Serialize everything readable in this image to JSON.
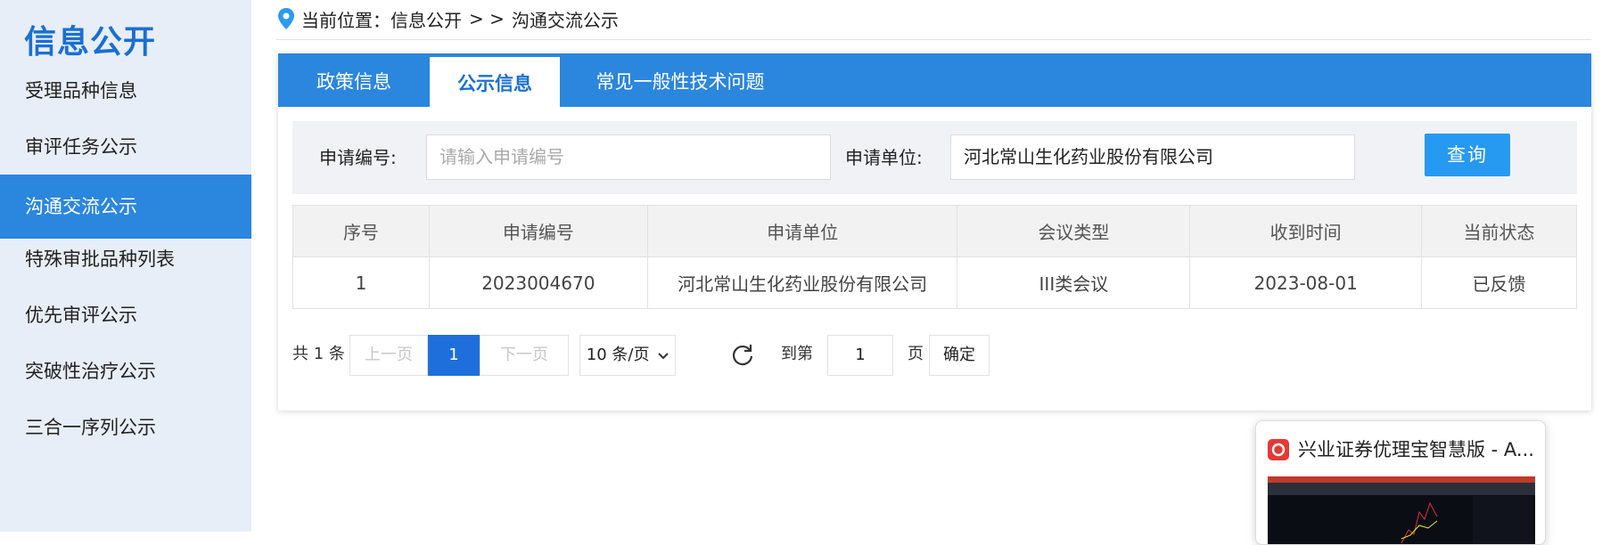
{
  "sidebar": {
    "title": "信息公开",
    "items": [
      {
        "label": "受理品种信息"
      },
      {
        "label": "审评任务公示"
      },
      {
        "label": "沟通交流公示"
      },
      {
        "label": "特殊审批品种列表"
      },
      {
        "label": "优先审评公示"
      },
      {
        "label": "突破性治疗公示"
      },
      {
        "label": "三合一序列公示"
      }
    ],
    "active_index": 2
  },
  "breadcrumb": {
    "prefix": "当前位置：",
    "level1": "信息公开",
    "separator": "> >",
    "current": "沟通交流公示"
  },
  "tabs": [
    {
      "label": "政策信息"
    },
    {
      "label": "公示信息"
    },
    {
      "label": "常见一般性技术问题"
    }
  ],
  "active_tab": 1,
  "search": {
    "app_no_label": "申请编号:",
    "app_no_placeholder": "请输入申请编号",
    "applicant_label": "申请单位:",
    "applicant_value": "河北常山生化药业股份有限公司",
    "query_button": "查询"
  },
  "table": {
    "headers": [
      "序号",
      "申请编号",
      "申请单位",
      "会议类型",
      "收到时间",
      "当前状态"
    ],
    "rows": [
      [
        "1",
        "2023004670",
        "河北常山生化药业股份有限公司",
        "III类会议",
        "2023-08-01",
        "已反馈"
      ]
    ]
  },
  "pagination": {
    "total_text": "共 1 条",
    "prev": "上一页",
    "current_page": "1",
    "next": "下一页",
    "page_size": "10 条/页",
    "goto_label": "到第",
    "goto_value": "1",
    "page_unit": "页",
    "confirm": "确定"
  },
  "taskbar_popup": {
    "title": "兴业证券优理宝智慧版 - A..."
  },
  "colors": {
    "brand_blue": "#2b86de",
    "query_blue": "#2699f1",
    "page_current": "#1e6fdc"
  }
}
